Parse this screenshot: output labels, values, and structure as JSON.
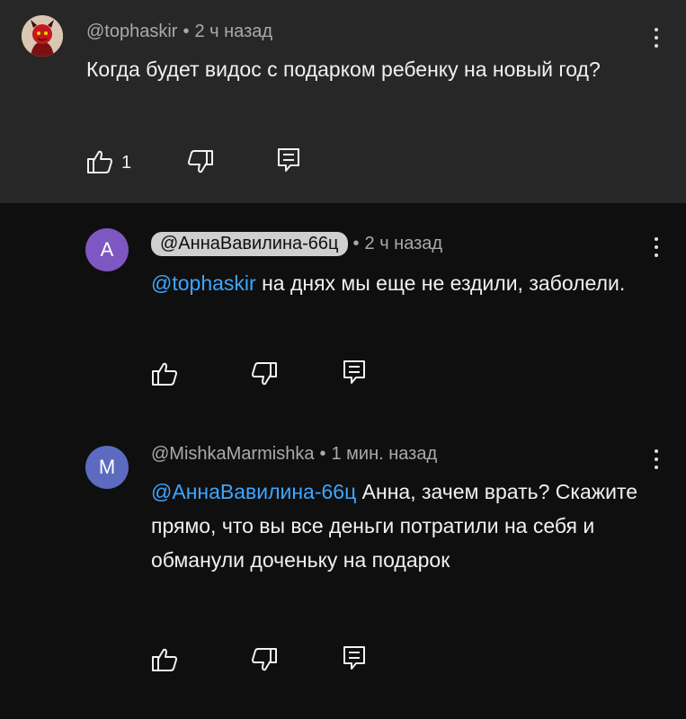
{
  "comments": [
    {
      "author": "@tophaskir",
      "time": "2 ч назад",
      "text": "Когда будет видос с подарком ребенку на новый год?",
      "likes": "1"
    },
    {
      "author": "@АннаВавилина-66ц",
      "avatar_letter": "A",
      "time": "2 ч назад",
      "mention": "@tophaskir",
      "text": " на днях мы еще не ездили, заболели."
    },
    {
      "author": "@MishkaMarmishka",
      "avatar_letter": "M",
      "time": "1 мин. назад",
      "mention": "@АннаВавилина-66ц",
      "text": " Анна, зачем врать? Скажите прямо, что вы все деньги потратили на себя и обманули доченьку на подарок"
    }
  ],
  "separator": "•",
  "icons": [
    "like-icon",
    "dislike-icon",
    "reply-icon",
    "more-vert-icon"
  ],
  "colors": {
    "background": "#0f0f0f",
    "highlighted_comment": "#272727",
    "mention": "#3ea6ff",
    "meta": "#aaaaaa"
  }
}
